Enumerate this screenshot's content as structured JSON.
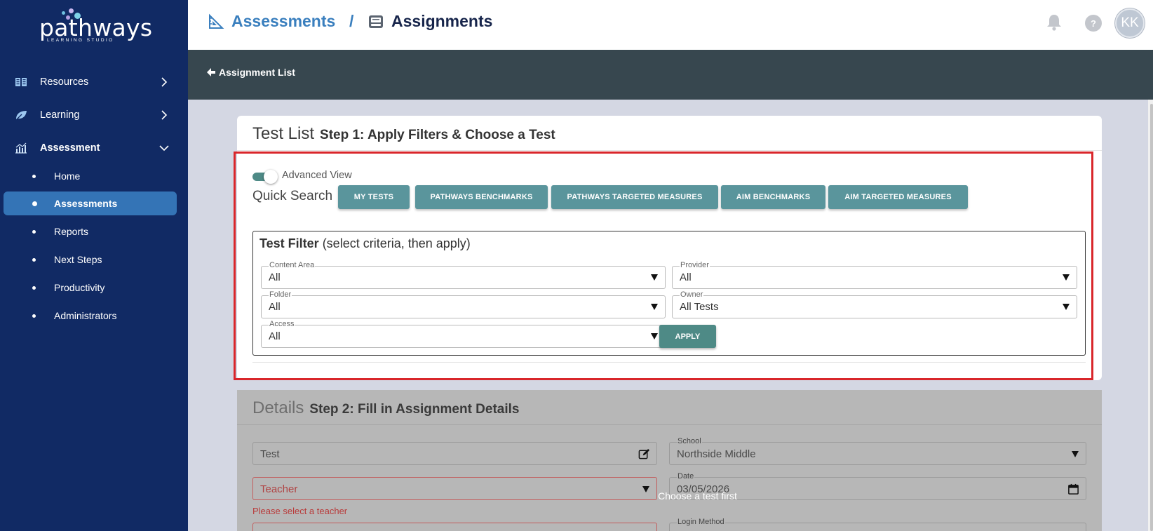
{
  "app": {
    "logo_text": "pathways",
    "logo_subtext": "LEARNING STUDIO"
  },
  "sidebar": {
    "items": [
      {
        "label": "Resources",
        "icon": "book-icon"
      },
      {
        "label": "Learning",
        "icon": "leaf-icon"
      },
      {
        "label": "Assessment",
        "icon": "chart-icon"
      }
    ],
    "subitems": [
      {
        "label": "Home"
      },
      {
        "label": "Assessments",
        "active": true
      },
      {
        "label": "Reports"
      },
      {
        "label": "Next Steps"
      },
      {
        "label": "Productivity"
      },
      {
        "label": "Administrators"
      }
    ]
  },
  "header": {
    "crumb_1": "Assessments",
    "separator": "/",
    "crumb_2": "Assignments",
    "help": "?",
    "avatar_initials": "KK"
  },
  "toolbar": {
    "back_label": "Assignment List"
  },
  "test_list": {
    "title": "Test List",
    "step": "Step 1: Apply Filters & Choose a Test",
    "advanced_view_label": "Advanced View",
    "advanced_view_on": true,
    "quick_search_label": "Quick Search",
    "quick_search_buttons": [
      "MY TESTS",
      "PATHWAYS BENCHMARKS",
      "PATHWAYS TARGETED MEASURES",
      "AIM BENCHMARKS",
      "AIM TARGETED MEASURES"
    ],
    "filter_title_bold": "Test Filter",
    "filter_title_rest": " (select criteria, then apply)",
    "filters": {
      "content_area": {
        "label": "Content Area",
        "value": "All"
      },
      "provider": {
        "label": "Provider",
        "value": "All"
      },
      "folder": {
        "label": "Folder",
        "value": "All"
      },
      "owner": {
        "label": "Owner",
        "value": "All Tests"
      },
      "access": {
        "label": "Access",
        "value": "All"
      }
    },
    "apply_label": "APPLY"
  },
  "details": {
    "title": "Details",
    "step": "Step 2: Fill in Assignment Details",
    "test_field": {
      "value": "Test"
    },
    "school_field": {
      "label": "School",
      "value": "Northside Middle"
    },
    "teacher_field": {
      "value": "Teacher"
    },
    "teacher_error": "Please select a teacher",
    "date_field": {
      "label": "Date",
      "value": "03/05/2026"
    },
    "login_method_field": {
      "label": "Login Method"
    },
    "overlay_text": "Choose a test first"
  },
  "colors": {
    "sidebar_bg": "#112a64",
    "active_item": "#3474b6",
    "teal_button": "#5a959c",
    "apply_button": "#4e8a86",
    "dark_bar": "#37474f",
    "highlight": "#d9262b"
  }
}
